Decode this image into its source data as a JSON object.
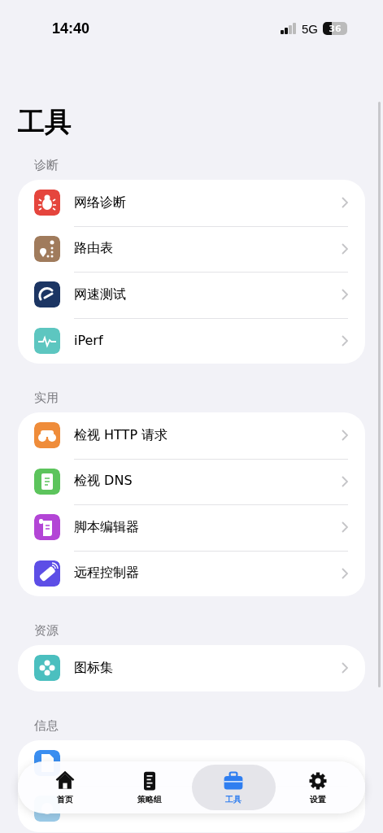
{
  "status_bar": {
    "time": "14:40",
    "network": "5G",
    "battery": "36"
  },
  "title": "工具",
  "sections": [
    {
      "header": "诊断",
      "items": [
        {
          "label": "网络诊断",
          "color": "#e5453d"
        },
        {
          "label": "路由表",
          "color": "#a07b5c"
        },
        {
          "label": "网速测试",
          "color": "#1c3563"
        },
        {
          "label": "iPerf",
          "color": "#5dc6c0"
        }
      ]
    },
    {
      "header": "实用",
      "items": [
        {
          "label": "检视 HTTP 请求",
          "color": "#ef8c3a"
        },
        {
          "label": "检视 DNS",
          "color": "#5cc45c"
        },
        {
          "label": "脚本编辑器",
          "color": "#b345d6"
        },
        {
          "label": "远程控制器",
          "color": "#5d4ee6"
        }
      ]
    },
    {
      "header": "资源",
      "items": [
        {
          "label": "图标集",
          "color": "#4bbfbf"
        }
      ]
    },
    {
      "header": "信息",
      "items": [
        {
          "color": "#3a8ef0"
        },
        {
          "color": "#9ccbe8"
        }
      ]
    }
  ],
  "tabs": [
    {
      "label": "首页",
      "selected": false
    },
    {
      "label": "策略组",
      "selected": false
    },
    {
      "label": "工具",
      "selected": true
    },
    {
      "label": "设置",
      "selected": false
    }
  ]
}
